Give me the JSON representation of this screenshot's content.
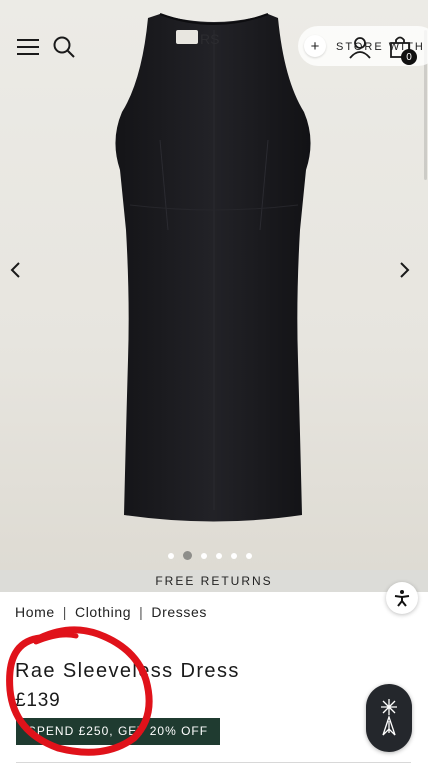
{
  "header": {
    "store_label": "STORE WITH",
    "bag_count": "0",
    "icons": [
      "menu-icon",
      "search-icon",
      "plus-icon",
      "account-icon",
      "bag-icon"
    ]
  },
  "gallery": {
    "total_images": 6,
    "active_index": 1,
    "image_description_colors": {
      "dress": "#1b1b1f",
      "background": "#e9e7e1"
    }
  },
  "banner": {
    "text": "FREE RETURNS"
  },
  "breadcrumb": {
    "items": [
      "Home",
      "Clothing",
      "Dresses"
    ],
    "separator": "|"
  },
  "product": {
    "title": "Rae Sleeveless Dress",
    "price": "£139"
  },
  "promo": {
    "text": "SPEND £250, GET 20% OFF",
    "color": "#1f3b30"
  },
  "annotation": {
    "color": "#e0121a"
  }
}
